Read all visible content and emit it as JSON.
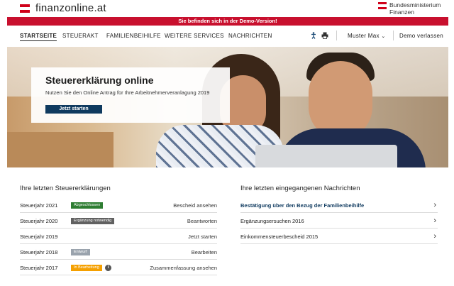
{
  "header": {
    "logo_text": "finanzonline.at",
    "ministry_line1": "Bundesministerium",
    "ministry_line2": "Finanzen"
  },
  "demo_banner": "Sie befinden sich in der Demo-Version!",
  "nav": {
    "items": [
      {
        "label": "STARTSEITE",
        "active": true
      },
      {
        "label": "STEUERAKT"
      },
      {
        "label": "FAMILIENBEIHILFE"
      },
      {
        "label": "WEITERE SERVICES"
      },
      {
        "label": "NACHRICHTEN"
      }
    ],
    "icons": [
      "accessibility-icon",
      "print-icon"
    ],
    "user_menu": "Muster Max",
    "logout": "Demo verlassen"
  },
  "hero": {
    "title": "Steuererklärung online",
    "subtitle": "Nutzen Sie den Online Antrag für Ihre Arbeitnehmerveranlagung 2019",
    "button": "Jetzt starten"
  },
  "tax_returns": {
    "title": "Ihre letzten Steuererklärungen",
    "rows": [
      {
        "year": "Steuerjahr 2021",
        "badge": "Abgeschlossen",
        "badge_color": "#2e7d32",
        "action": "Bescheid ansehen"
      },
      {
        "year": "Steuerjahr 2020",
        "badge": "Ergänzung notwendig",
        "badge_color": "#616161",
        "action": "Beantworten"
      },
      {
        "year": "Steuerjahr 2019",
        "badge": "",
        "badge_color": "",
        "action": "Jetzt starten"
      },
      {
        "year": "Steuerjahr 2018",
        "badge": "Entwurf",
        "badge_color": "#9aa3ad",
        "action": "Bearbeiten"
      },
      {
        "year": "Steuerjahr 2017",
        "badge": "In Bearbeitung",
        "badge_color": "#f5a000",
        "action": "Zusammenfassung ansehen"
      }
    ]
  },
  "messages": {
    "title": "Ihre letzten eingegangenen Nachrichten",
    "rows": [
      {
        "text": "Bestätigung über den Bezug der Familienbeihilfe",
        "unread": true
      },
      {
        "text": "Ergänzungsersuchen 2016",
        "unread": false
      },
      {
        "text": "Einkommensteuerbescheid 2015",
        "unread": false
      }
    ]
  },
  "colors": {
    "brand_red": "#c8102e",
    "primary_blue": "#0f3a5f"
  }
}
